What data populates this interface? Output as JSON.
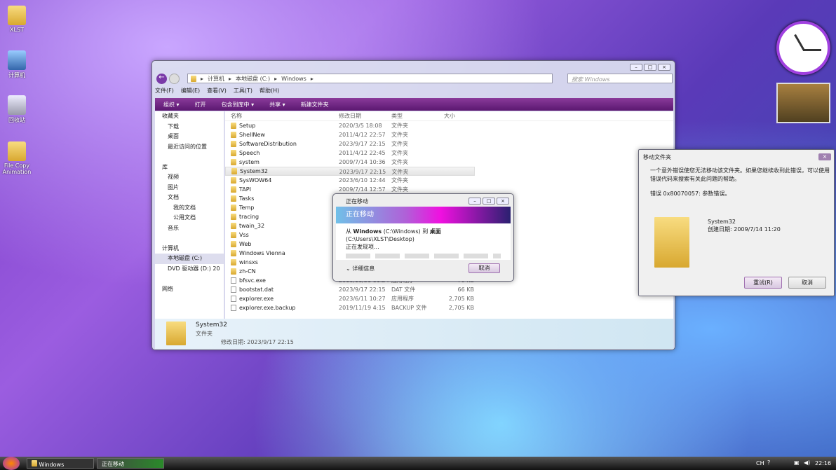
{
  "desktop": [
    {
      "label": "XLST"
    },
    {
      "label": "计算机"
    },
    {
      "label": "回收站"
    },
    {
      "label": "File Copy Animation"
    }
  ],
  "explorer": {
    "breadcrumb": [
      "计算机",
      "本地磁盘 (C:)",
      "Windows"
    ],
    "search_placeholder": "搜索 Windows",
    "menu": [
      "文件(F)",
      "编辑(E)",
      "查看(V)",
      "工具(T)",
      "帮助(H)"
    ],
    "toolbar": [
      "组织 ▾",
      "打开",
      "包含到库中 ▾",
      "共享 ▾",
      "新建文件夹"
    ],
    "sidebar": [
      "收藏夹",
      "下载",
      "桌面",
      "最近访问的位置",
      "",
      "库",
      "视频",
      "图片",
      "文档",
      "我的文档",
      "公用文档",
      "音乐",
      "",
      "计算机",
      "本地磁盘 (C:)",
      "DVD 驱动器 (D:) 20",
      "",
      "网络"
    ],
    "columns": [
      "名称",
      "修改日期",
      "类型",
      "大小"
    ],
    "rows": [
      [
        "Setup",
        "2020/3/5 18:08",
        "文件夹",
        ""
      ],
      [
        "ShellNew",
        "2011/4/12 22:57",
        "文件夹",
        ""
      ],
      [
        "SoftwareDistribution",
        "2023/9/17 22:15",
        "文件夹",
        ""
      ],
      [
        "Speech",
        "2011/4/12 22:45",
        "文件夹",
        ""
      ],
      [
        "system",
        "2009/7/14 10:36",
        "文件夹",
        ""
      ],
      [
        "System32",
        "2023/9/17 22:15",
        "文件夹",
        ""
      ],
      [
        "SysWOW64",
        "2023/6/10 12:44",
        "文件夹",
        ""
      ],
      [
        "TAPI",
        "2009/7/14 12:57",
        "文件夹",
        ""
      ],
      [
        "Tasks",
        "",
        "",
        ""
      ],
      [
        "Temp",
        "",
        "",
        ""
      ],
      [
        "tracing",
        "",
        "",
        ""
      ],
      [
        "twain_32",
        "",
        "",
        ""
      ],
      [
        "Vss",
        "",
        "",
        ""
      ],
      [
        "Web",
        "",
        "",
        ""
      ],
      [
        "Windows Vienna",
        "",
        "",
        ""
      ],
      [
        "winsxs",
        "",
        "",
        ""
      ],
      [
        "zh-CN",
        "",
        "",
        ""
      ],
      [
        "bfsvc.exe",
        "2010/11/21 11:24",
        "应用程序",
        "70 KB"
      ],
      [
        "bootstat.dat",
        "2023/9/17 22:15",
        "DAT 文件",
        "66 KB"
      ],
      [
        "explorer.exe",
        "2023/6/11 10:27",
        "应用程序",
        "2,705 KB"
      ],
      [
        "explorer.exe.backup",
        "2019/11/19 4:15",
        "BACKUP 文件",
        "2,705 KB"
      ]
    ],
    "details": {
      "name": "System32",
      "type": "文件夹",
      "modified": "修改日期: 2023/9/17 22:15"
    }
  },
  "progress": {
    "title": "正在移动",
    "banner": "正在移动",
    "from": "从",
    "src": "Windows",
    "src_path": "(C:\\Windows) 到",
    "dst": "桌面",
    "dst_path": "(C:\\Users\\XLST\\Desktop)",
    "status": "正在发现项...",
    "more": "详细信息",
    "cancel": "取消"
  },
  "error": {
    "title": "移动文件夹",
    "message": "一个意外错误使您无法移动该文件夹。如果您继续收到此错误，可以使用错误代码来搜索有关此问题的帮助。",
    "code": "错误 0x80070057: 参数错误。",
    "item": "System32",
    "created": "创建日期: 2009/7/14 11:20",
    "retry": "重试(R)",
    "cancel": "取消"
  },
  "taskbar": {
    "items": [
      "Windows",
      "正在移动"
    ],
    "lang": "CH",
    "time": "22:16"
  }
}
